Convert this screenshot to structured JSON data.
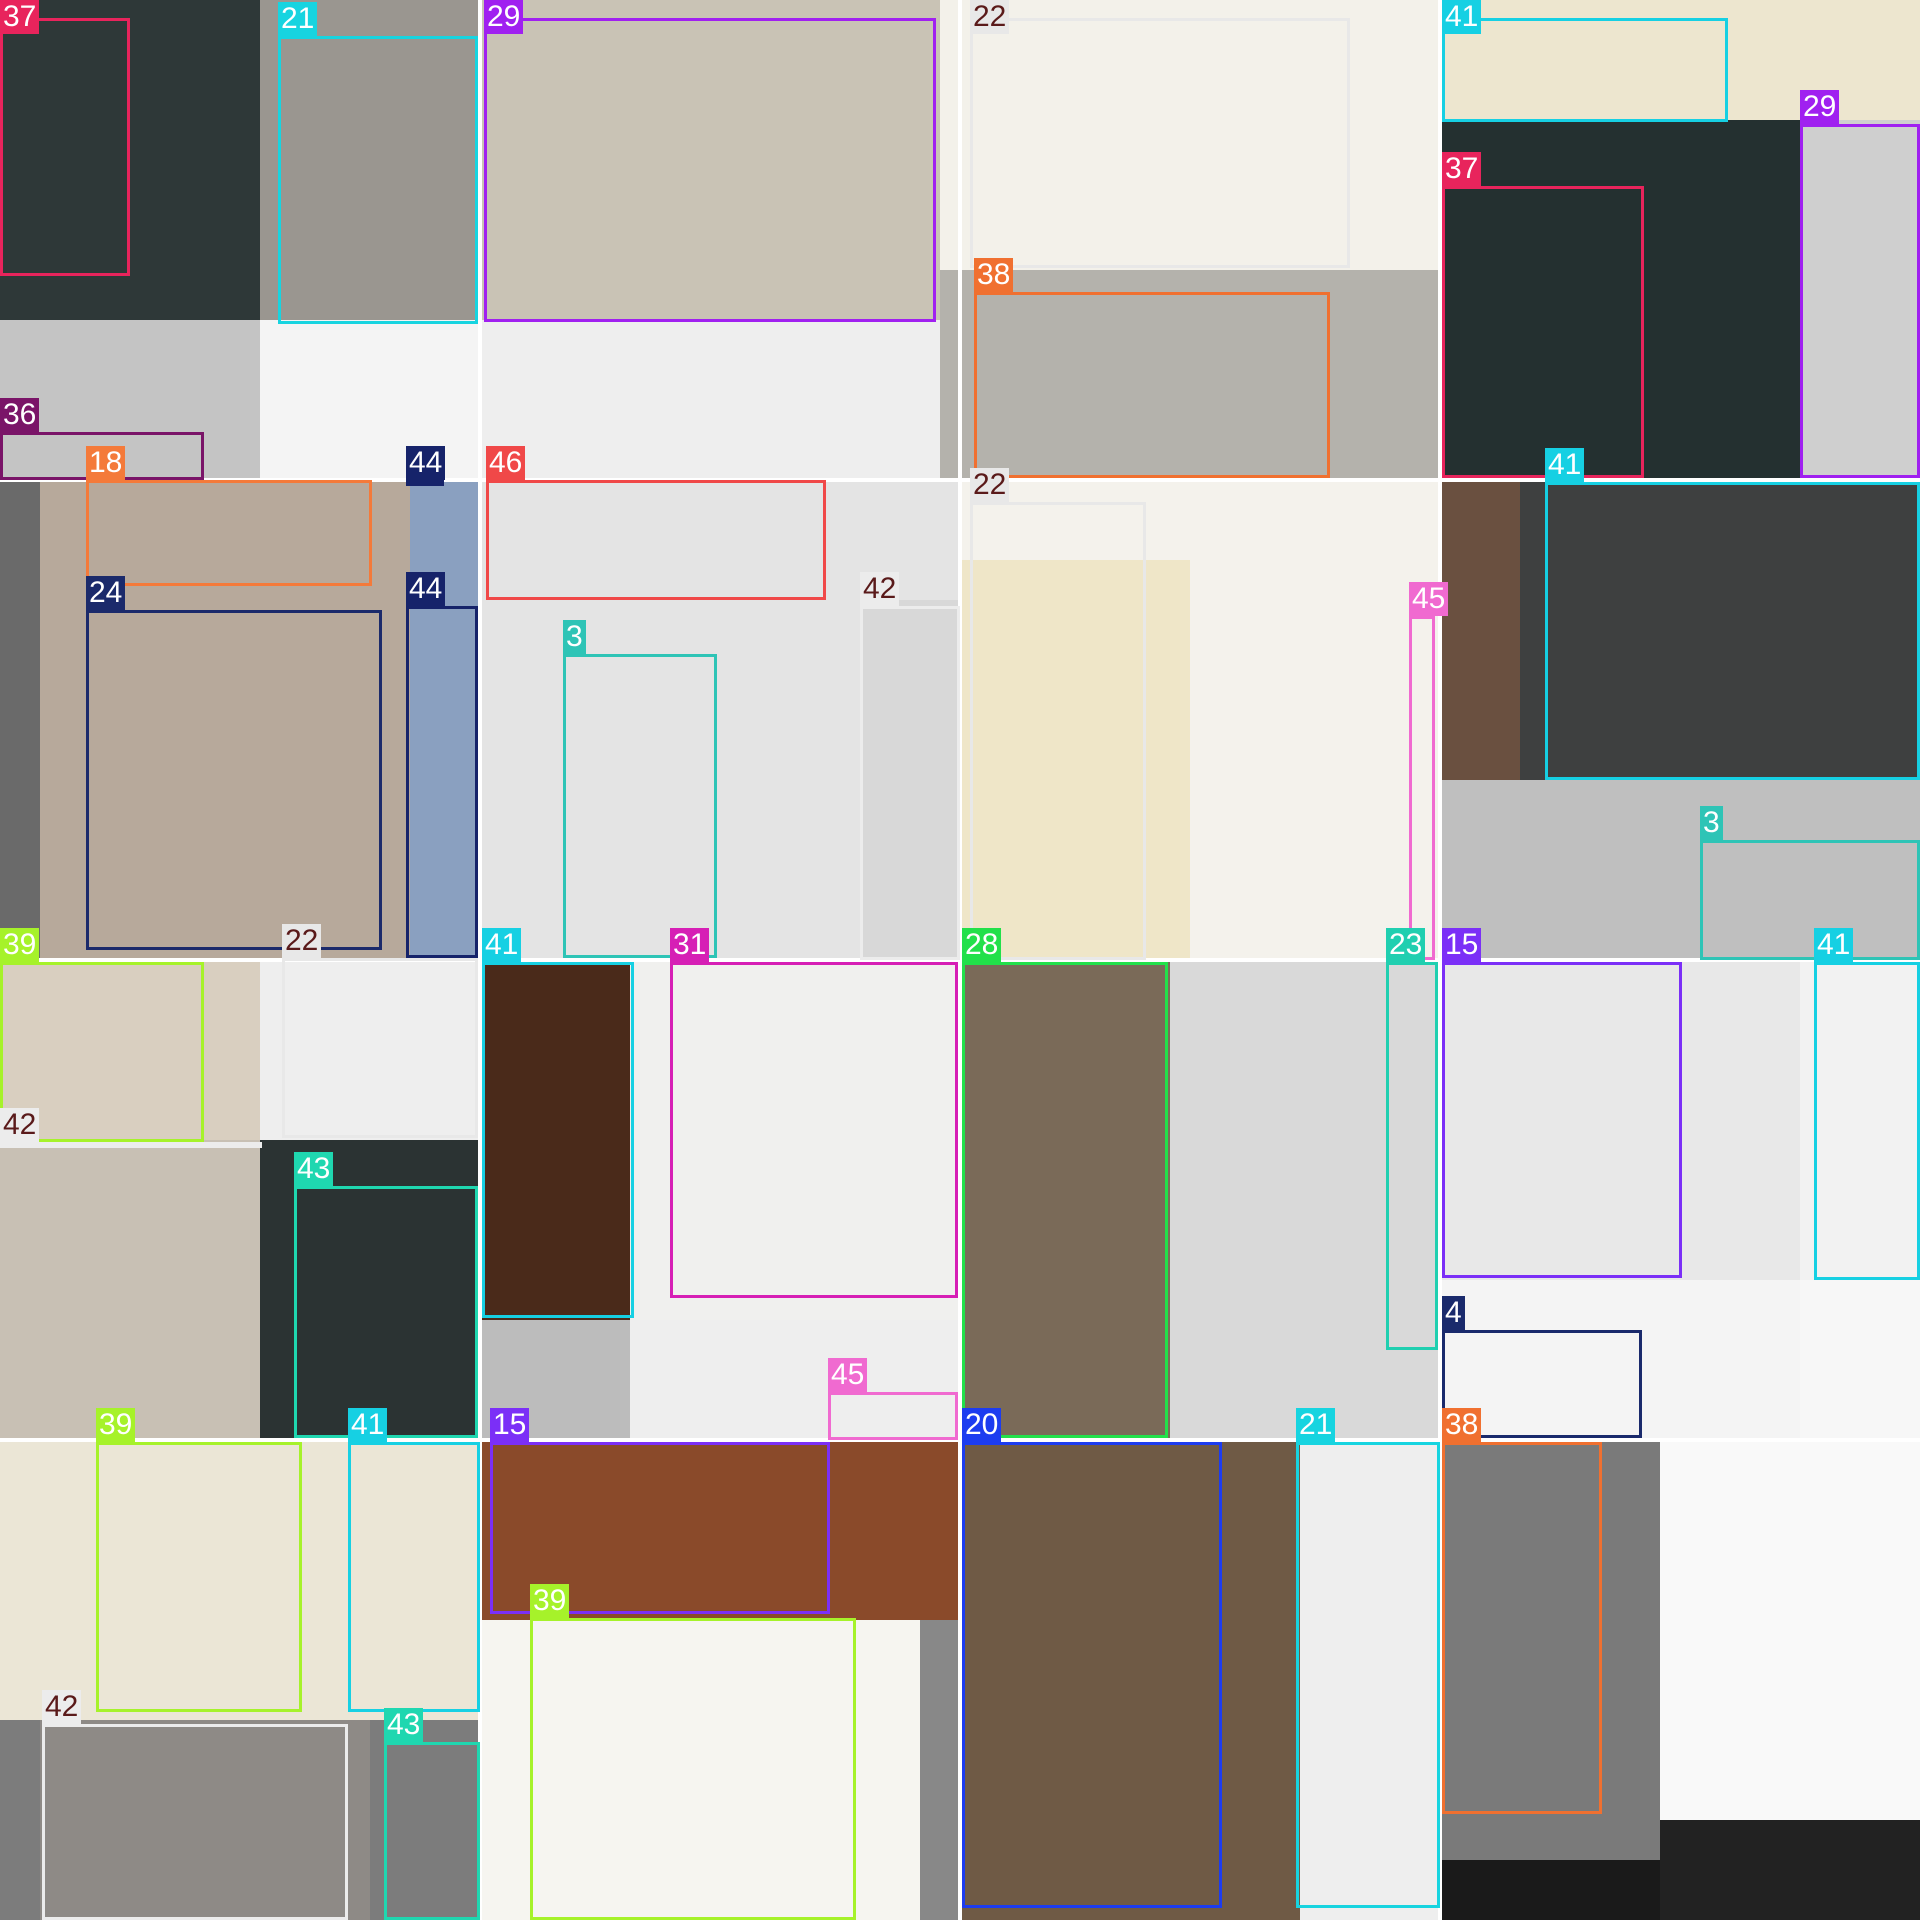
{
  "title": "",
  "tile_filenames": [
    "sign-08-3-_jpg.rf.f7d3a254",
    "sign-42-2-_jpg.rf.33",
    "1e095d28561b019129f5e0",
    "8b0fb1825df8f24f0c3444f6c3044",
    "998ff148c89039299a53b8",
    "8b0fb1825df8f24f0c32a97effe",
    "8b10c405493e67fff0eba4aef",
    "7dfc6e22582c159526c54",
    "596f809554ef74682",
    "a0b9790dd5f028d929a46",
    "bc9d2da92d36fa3c2f01271",
    "fb012973ab765b92a697ee7536",
    "sign-06-1-_jpg.rf.ec"
  ],
  "class_colors": {
    "3": "#2ec4b6",
    "4": "#1a2a6c",
    "15": "#7b2ff7",
    "18": "#f47a3a",
    "20": "#1c3cf0",
    "21": "#17d4e0",
    "22": "#e8e8e8",
    "23": "#20cfb0",
    "24": "#1b2a6b",
    "28": "#22e04a",
    "29": "#a020f0",
    "31": "#d61fb5",
    "36": "#7a1468",
    "37": "#e8245c",
    "38": "#f07030",
    "39": "#a6f22a",
    "41": "#16d0e3",
    "42": "#ececec",
    "43": "#1fd7b0",
    "44": "#16236a",
    "45": "#f06ad0",
    "46": "#f04848"
  },
  "labels": [
    "37",
    "21",
    "29",
    "22",
    "41",
    "29",
    "37",
    "38",
    "36",
    "18",
    "44",
    "46",
    "22",
    "42",
    "24",
    "44",
    "3",
    "45",
    "41",
    "3",
    "22",
    "39",
    "42",
    "43",
    "41",
    "31",
    "28",
    "23",
    "15",
    "41",
    "4",
    "45",
    "39",
    "41",
    "15",
    "39",
    "20",
    "21",
    "38",
    "42",
    "43"
  ]
}
